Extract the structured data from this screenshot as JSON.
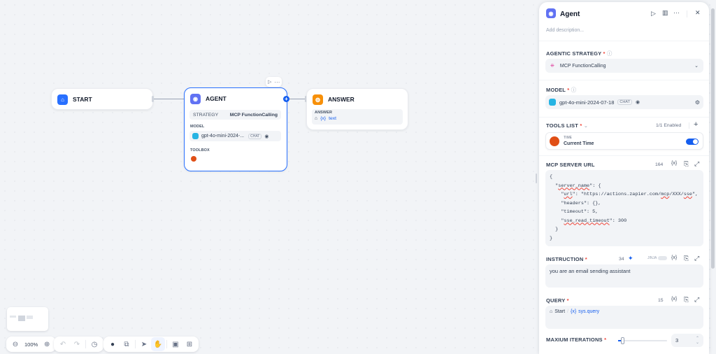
{
  "canvas": {
    "start_node": {
      "title": "START"
    },
    "agent_node": {
      "title": "AGENT",
      "strategy_label": "STRATEGY",
      "strategy_value": "MCP FunctionCalling",
      "model_label": "MODEL",
      "model_name": "gpt-4o-mini-2024-...",
      "model_badge": "CHAT",
      "toolbox_label": "TOOLBOX"
    },
    "answer_node": {
      "title": "ANSWER",
      "answer_label": "ANSWER",
      "var_prefix": "{x}",
      "var_name": "text"
    },
    "zoom": "100%"
  },
  "panel": {
    "title": "Agent",
    "description_placeholder": "Add description...",
    "strategy": {
      "label": "AGENTIC STRATEGY",
      "value": "MCP FunctionCalling"
    },
    "model": {
      "label": "MODEL",
      "value": "gpt-4o-mini-2024-07-18",
      "badge": "CHAT"
    },
    "tools": {
      "label": "TOOLS LIST",
      "enabled": "1/1 Enabled",
      "tool_provider": "TIME",
      "tool_name": "Current Time"
    },
    "mcp": {
      "label": "MCP SERVER URL",
      "count": "164",
      "lines": [
        "{",
        "  \"server_name\": {",
        "    \"url\": \"https://actions.zapier.com/mcp/XXX/sse\",",
        "    \"headers\": {},",
        "    \"timeout\": 5,",
        "    \"sse_read_timeout\": 300",
        "  }",
        "}"
      ]
    },
    "instruction": {
      "label": "INSTRUCTION",
      "count": "34",
      "jinja": "JINJA",
      "value": "you are an email sending assistant"
    },
    "query": {
      "label": "QUERY",
      "count": "15",
      "source": "Start",
      "var_prefix": "{x}",
      "var": "sys.query"
    },
    "iterations": {
      "label": "MAXIUM ITERATIONS",
      "value": "3",
      "level": 0.05
    }
  },
  "colors": {
    "accent": "#155eef",
    "agent": "#6172f3",
    "answer": "#f79009",
    "tool": "#e04f16"
  }
}
